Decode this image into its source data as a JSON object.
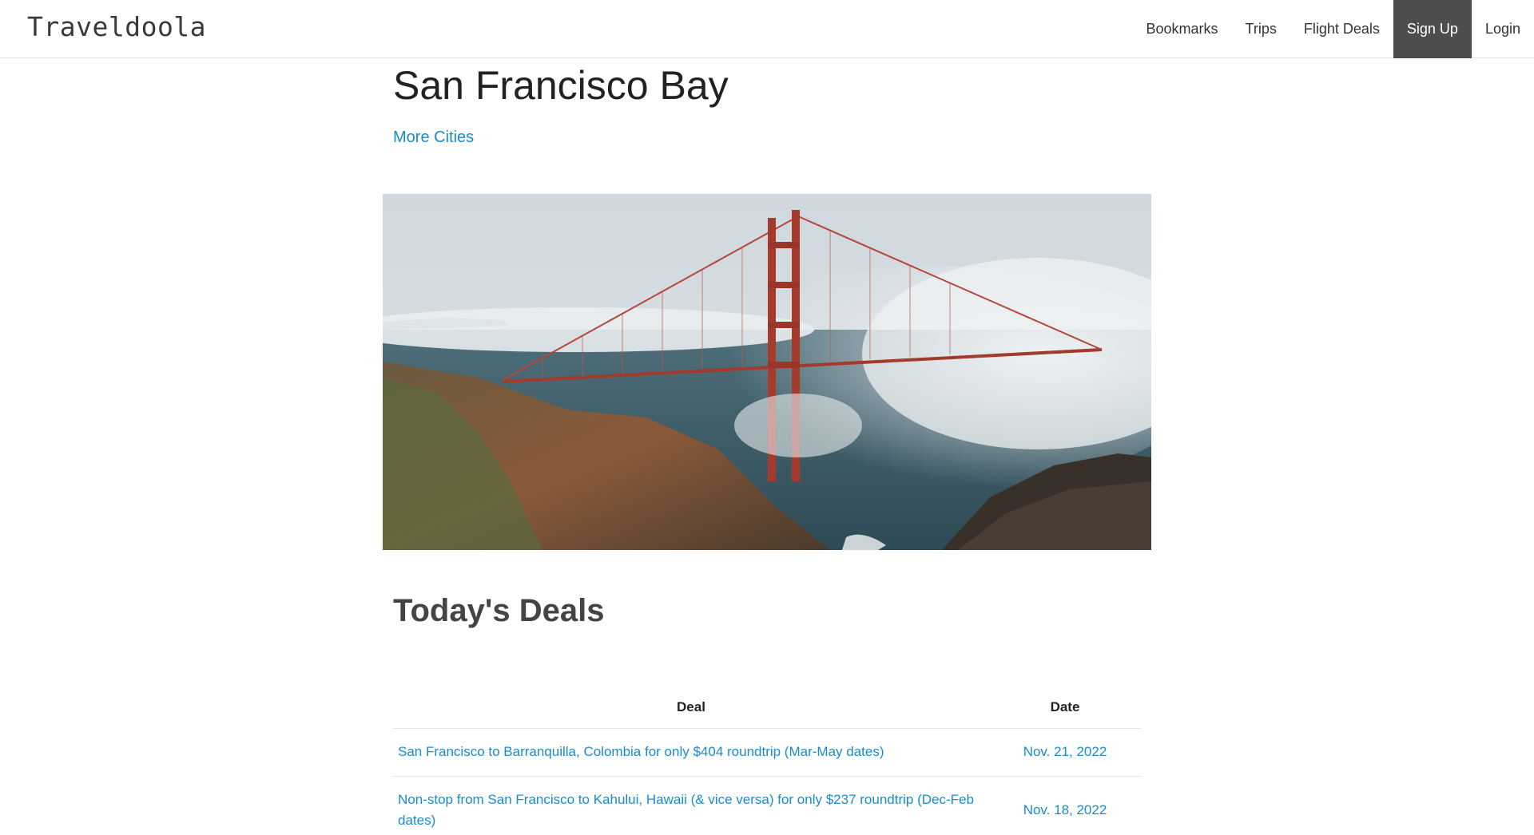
{
  "brand": {
    "name": "Traveldoola"
  },
  "nav": {
    "items": [
      {
        "label": "Bookmarks"
      },
      {
        "label": "Trips"
      },
      {
        "label": "Flight Deals"
      },
      {
        "label": "Sign Up",
        "active": true
      },
      {
        "label": "Login"
      }
    ]
  },
  "city": {
    "title": "San Francisco Bay",
    "more_cities_label": "More Cities"
  },
  "deals": {
    "heading": "Today's Deals",
    "columns": [
      "Deal",
      "Date"
    ],
    "rows": [
      {
        "deal": "San Francisco to Barranquilla, Colombia for only $404 roundtrip (Mar-May dates)",
        "date": "Nov. 21, 2022"
      },
      {
        "deal": "Non-stop from San Francisco to Kahului, Hawaii (& vice versa) for only $237 roundtrip (Dec-Feb dates)",
        "date": "Nov. 18, 2022"
      }
    ]
  },
  "colors": {
    "link": "#1a8ccc",
    "nav_active_bg": "#4d4d4d",
    "heading": "#444444"
  }
}
